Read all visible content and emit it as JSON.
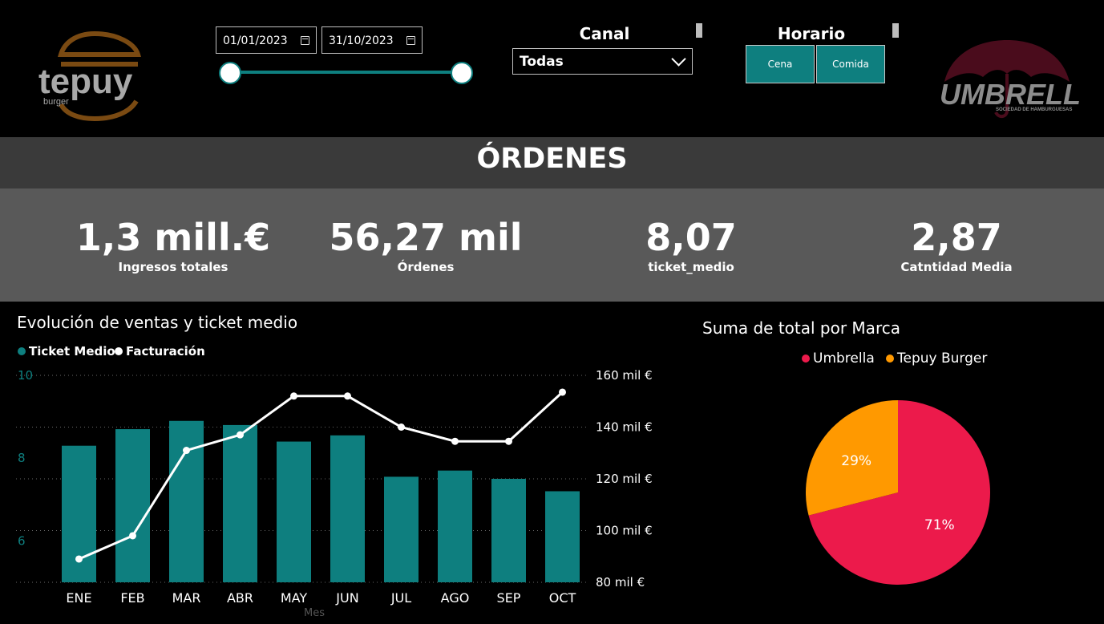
{
  "brand_left": {
    "name": "tepuy",
    "sub": "burger"
  },
  "brand_right": {
    "name": "UMBRELLA",
    "sub": "SOCIEDAD DE HAMBURGUESAS"
  },
  "date_filter": {
    "start": "01/01/2023",
    "end": "31/10/2023",
    "range_fraction": [
      0,
      1
    ]
  },
  "canal": {
    "title": "Canal",
    "selected": "Todas"
  },
  "horario": {
    "title": "Horario",
    "options": [
      "Cena",
      "Comida"
    ]
  },
  "section_title": "ÓRDENES",
  "kpis": [
    {
      "value": "1,3 mill.€",
      "label": "Ingresos totales"
    },
    {
      "value": "56,27 mil",
      "label": "Órdenes"
    },
    {
      "value": "8,07",
      "label": "ticket_medio"
    },
    {
      "value": "2,87",
      "label": "Catntidad Media"
    }
  ],
  "colors": {
    "teal": "#0e7f7f",
    "umbrella": "#ec1a4b",
    "tepuy": "#ff9900"
  },
  "chart_data": [
    {
      "type": "bar",
      "title": "Evolución de ventas y ticket medio",
      "xlabel": "Mes",
      "categories": [
        "ENE",
        "FEB",
        "MAR",
        "ABR",
        "MAY",
        "JUN",
        "JUL",
        "AGO",
        "SEP",
        "OCT"
      ],
      "series": [
        {
          "name": "Ticket Medio",
          "kind": "bar",
          "axis": "left",
          "values": [
            8.3,
            8.7,
            8.9,
            8.8,
            8.4,
            8.55,
            7.55,
            7.7,
            7.5,
            7.2
          ]
        },
        {
          "name": "Facturación",
          "kind": "line",
          "axis": "right",
          "values": [
            89000,
            98000,
            131000,
            137000,
            152000,
            152000,
            140000,
            134500,
            134500,
            153500
          ]
        }
      ],
      "left_axis": {
        "ylim": [
          5,
          10
        ],
        "ticks": [
          6,
          8,
          10
        ]
      },
      "right_axis": {
        "ylim": [
          80000,
          160000
        ],
        "ticks": [
          "80 mil €",
          "100 mil €",
          "120 mil €",
          "140 mil €",
          "160 mil €"
        ]
      },
      "legend_position": "top-left"
    },
    {
      "type": "pie",
      "title": "Suma de total por Marca",
      "labels": [
        "Umbrella",
        "Tepuy Burger"
      ],
      "values": [
        71,
        29
      ],
      "data_labels": [
        "71%",
        "29%"
      ],
      "legend_position": "top"
    }
  ]
}
